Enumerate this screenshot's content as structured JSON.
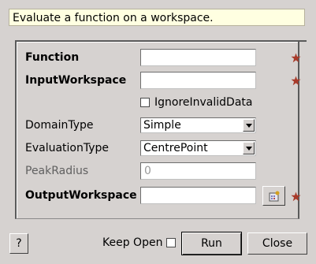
{
  "description": "Evaluate a function on a workspace.",
  "properties": {
    "function": {
      "label": "Function",
      "value": ""
    },
    "input_workspace": {
      "label": "InputWorkspace",
      "value": ""
    },
    "ignore_invalid_data": {
      "label": "IgnoreInvalidData",
      "checked": false
    },
    "domain_type": {
      "label": "DomainType",
      "selected": "Simple"
    },
    "evaluation_type": {
      "label": "EvaluationType",
      "selected": "CentrePoint"
    },
    "peak_radius": {
      "label": "PeakRadius",
      "value": "0"
    },
    "output_workspace": {
      "label": "OutputWorkspace",
      "value": ""
    }
  },
  "footer": {
    "help_label": "?",
    "keep_open_label": "Keep Open",
    "keep_open_checked": false,
    "run_label": "Run",
    "close_label": "Close"
  },
  "icons": {
    "required_marker": "star-icon",
    "browse": "workspace-browse-icon",
    "dropdown": "chevron-down-icon"
  },
  "colors": {
    "background": "#d6d2d0",
    "description_bg": "#ffffe1",
    "required_star": "#a83a2a"
  }
}
